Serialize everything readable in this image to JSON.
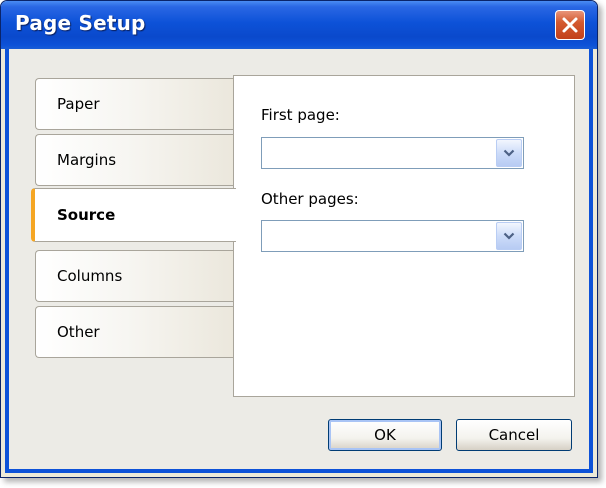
{
  "window": {
    "title": "Page Setup",
    "colors": {
      "titlebar": "#0d52d8",
      "active_tab_accent": "#f5a623",
      "close_button": "#c2401a"
    }
  },
  "close_button": {
    "icon": "close-icon"
  },
  "tabs": [
    {
      "label": "Paper",
      "selected": false
    },
    {
      "label": "Margins",
      "selected": false
    },
    {
      "label": "Source",
      "selected": true
    },
    {
      "label": "Columns",
      "selected": false
    },
    {
      "label": "Other",
      "selected": false
    }
  ],
  "source_panel": {
    "first_page": {
      "label": "First page:",
      "value": "",
      "icon": "chevron-down-icon"
    },
    "other_pages": {
      "label": "Other pages:",
      "value": "",
      "icon": "chevron-down-icon"
    }
  },
  "buttons": {
    "ok": "OK",
    "cancel": "Cancel"
  }
}
